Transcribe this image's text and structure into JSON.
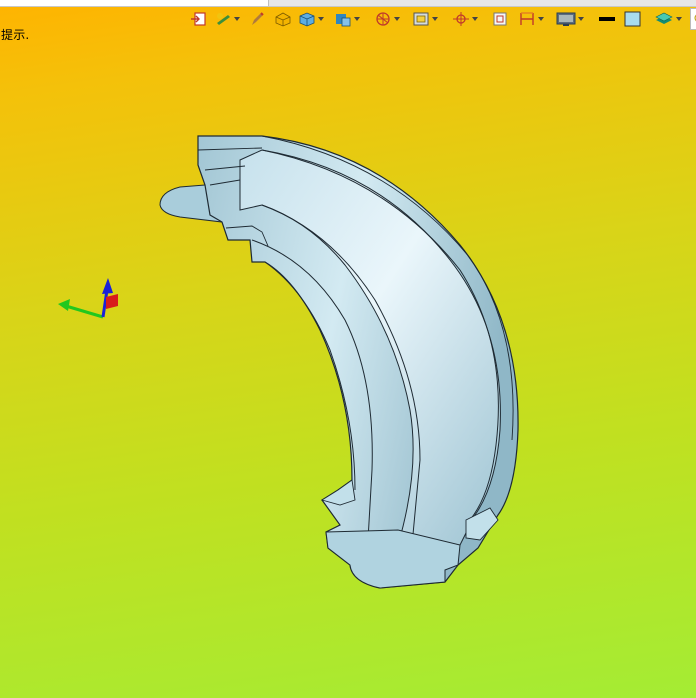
{
  "hint_label": "提示.",
  "toolbar": {
    "buttons": [
      {
        "name": "exit-sketch-icon"
      },
      {
        "name": "light-bulb-edit-icon",
        "dropdown": true
      },
      {
        "name": "pencil-icon"
      },
      {
        "name": "box-shade-icon"
      },
      {
        "name": "cube-view-icon",
        "dropdown": true
      },
      {
        "name": "view-cube-blue-icon",
        "dropdown": true
      },
      {
        "name": "section-circle-icon",
        "dropdown": true
      },
      {
        "name": "frame-view-icon",
        "dropdown": true
      },
      {
        "name": "target-icon",
        "dropdown": true
      },
      {
        "name": "window-fit-icon"
      },
      {
        "name": "dimension-icon",
        "dropdown": true
      },
      {
        "name": "monitor-icon",
        "dropdown": true
      },
      {
        "name": "line-color-black-icon"
      },
      {
        "name": "face-color-blue-icon"
      },
      {
        "name": "layer-stack-icon",
        "dropdown": true
      },
      {
        "name": "light-icon"
      }
    ]
  },
  "colors": {
    "background_top": "#ffb300",
    "background_bottom": "#a4ec34",
    "part_face": "#b7d6e2",
    "part_edge": "#1e2a33",
    "axis_x": "#22c81e",
    "axis_y": "#d81c1c",
    "axis_z": "#1a22d8"
  }
}
